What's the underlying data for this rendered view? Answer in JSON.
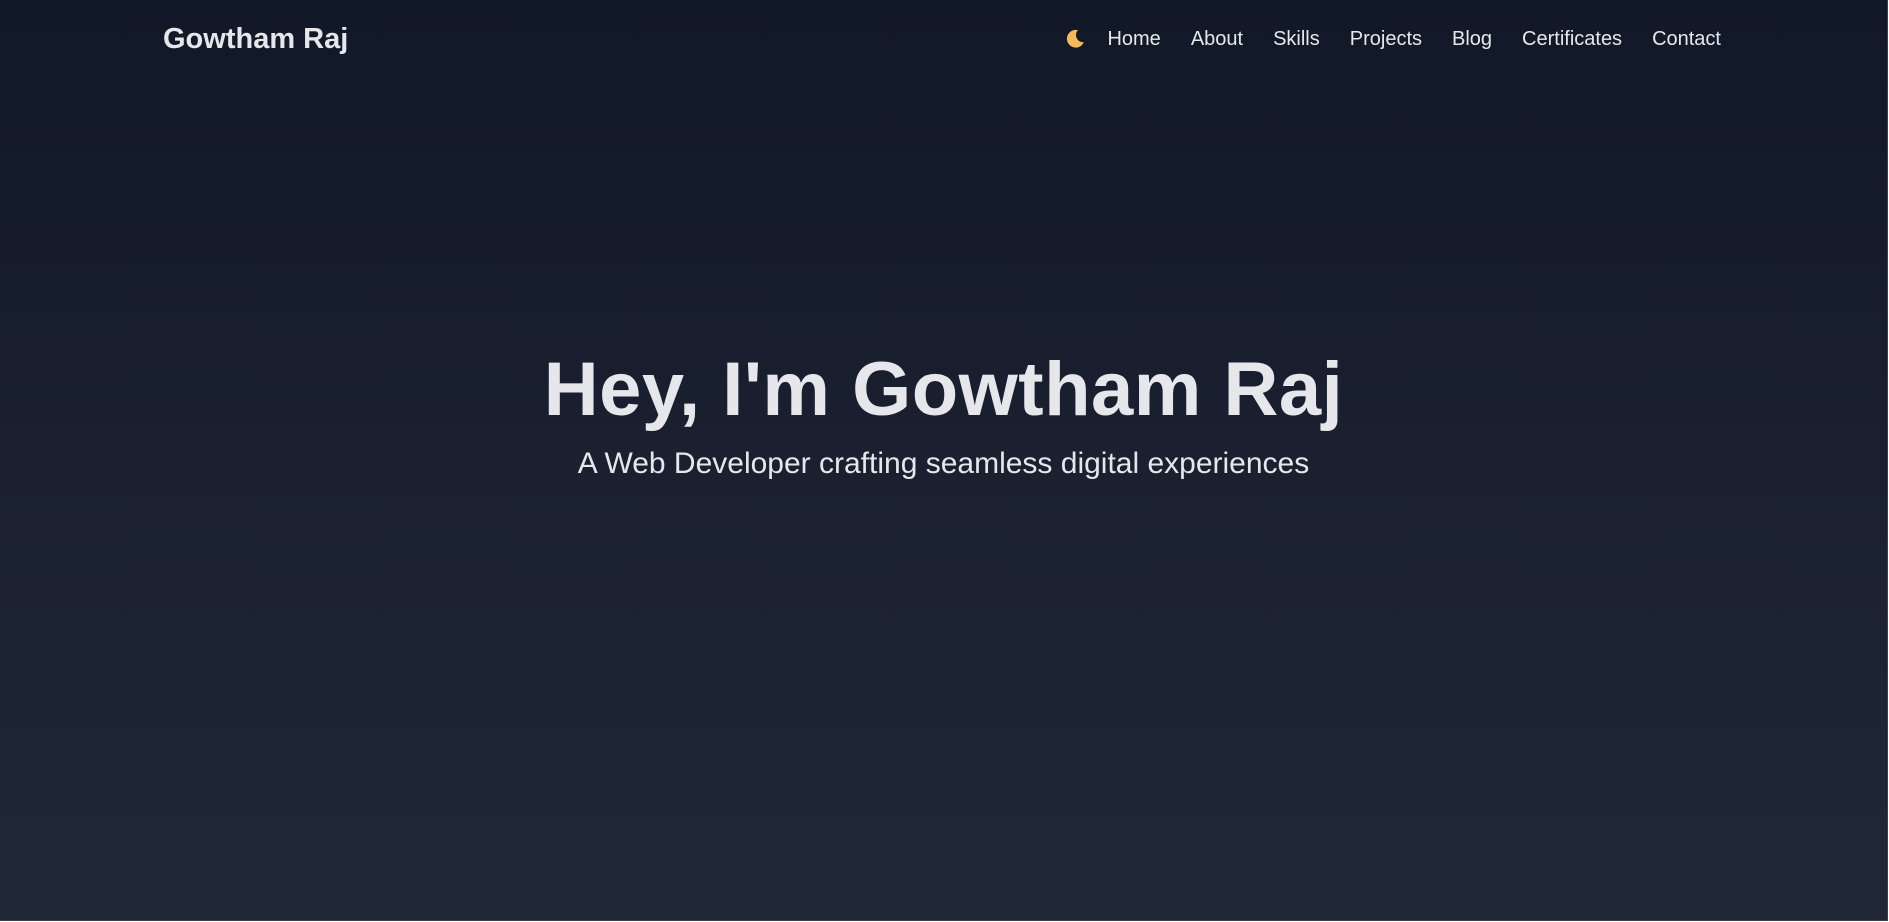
{
  "site": {
    "brand": "Gowtham Raj"
  },
  "nav": {
    "theme_icon": "moon-icon",
    "theme_icon_color": "#f6ba55",
    "links": [
      {
        "label": "Home"
      },
      {
        "label": "About"
      },
      {
        "label": "Skills"
      },
      {
        "label": "Projects"
      },
      {
        "label": "Blog"
      },
      {
        "label": "Certificates"
      },
      {
        "label": "Contact"
      }
    ]
  },
  "hero": {
    "title": "Hey, I'm Gowtham Raj",
    "subtitle": "A Web Developer crafting seamless digital experiences"
  },
  "colors": {
    "background_top": "#111827",
    "background_bottom": "#202837",
    "text": "#e5e7eb"
  }
}
